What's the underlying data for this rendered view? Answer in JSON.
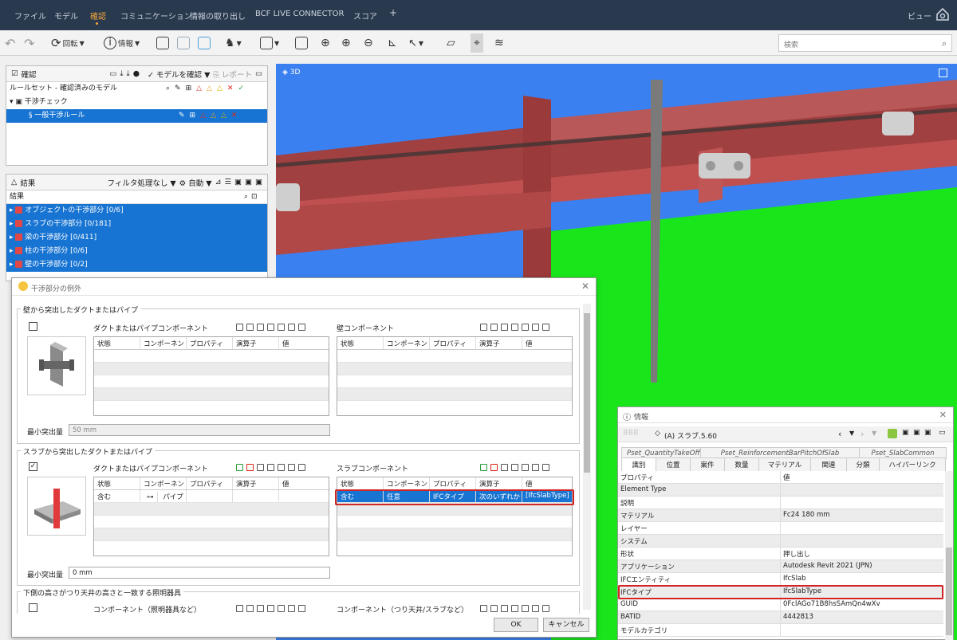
{
  "menu": {
    "items": [
      "ファイル",
      "モデル",
      "確認",
      "コミュニケーション",
      "情報の取り出し",
      "BCF LIVE CONNECTOR",
      "スコア",
      "+"
    ],
    "active_index": 2,
    "right": "ビュー"
  },
  "toolbar": {
    "rotate": "回転",
    "info": "情報",
    "search_placeholder": "検索"
  },
  "check_panel": {
    "title": "確認",
    "check_model": "モデルを確認",
    "report": "レポート",
    "ruleset": "ルールセット - 確認済みのモデル",
    "clash_check": "干渉チェック",
    "general_rule": "一般干渉ルール"
  },
  "results_panel": {
    "title": "結果",
    "filter": "フィルタ処理なし",
    "auto": "自動",
    "column": "結果",
    "items": [
      "オブジェクトの干渉部分 [0/6]",
      "スラブの干渉部分 [0/181]",
      "梁の干渉部分 [0/411]",
      "柱の干渉部分 [0/6]",
      "壁の干渉部分 [0/2]"
    ]
  },
  "view3d": {
    "label": "3D"
  },
  "dialog": {
    "title": "干渉部分の例外",
    "group1": {
      "title": "壁から突出したダクトまたはパイプ",
      "left_label": "ダクトまたはパイプコンポーネント",
      "right_label": "壁コンポーネント",
      "min_label": "最小突出量",
      "min_value": "50 mm"
    },
    "group2": {
      "title": "スラブから突出したダクトまたはパイプ",
      "left_label": "ダクトまたはパイプコンポーネント",
      "right_label": "スラブコンポーネント",
      "left_row": [
        "含む",
        "パイプ",
        "",
        "",
        ""
      ],
      "right_row": [
        "含む",
        "任意",
        "IFCタイプ",
        "次のいずれか",
        "[IfcSlabType]"
      ],
      "min_label": "最小突出量",
      "min_value": "0 mm"
    },
    "group3": {
      "title": "下側の高さがつり天井の高さと一致する照明器具",
      "left_label": "コンポーネント（照明器具など）",
      "right_label": "コンポーネント（つり天井/スラブなど）"
    },
    "columns": [
      "状態",
      "コンポーネント",
      "プロパティ",
      "演算子",
      "値"
    ],
    "ok": "OK",
    "cancel": "キャンセル"
  },
  "info": {
    "title": "情報",
    "object": "(A) スラブ.5.60",
    "tabs_top": [
      "Pset_QuantityTakeOff",
      "Pset_ReinforcementBarPitchOfSlab",
      "Pset_SlabCommon"
    ],
    "tabs": [
      "識別",
      "位置",
      "案件",
      "数量",
      "マテリアル",
      "関連",
      "分類",
      "ハイパーリンク"
    ],
    "head": [
      "プロパティ",
      "値"
    ],
    "rows": [
      [
        "Element Type",
        ""
      ],
      [
        "説明",
        ""
      ],
      [
        "マテリアル",
        "Fc24 180 mm"
      ],
      [
        "レイヤー",
        ""
      ],
      [
        "システム",
        ""
      ],
      [
        "形状",
        "押し出し"
      ],
      [
        "アプリケーション",
        "Autodesk Revit 2021 (JPN)"
      ],
      [
        "IFCエンティティ",
        "IfcSlab"
      ],
      [
        "IFCタイプ",
        "IfcSlabType"
      ],
      [
        "GUID",
        "0FclAGo71B8hsSAmQn4wXv"
      ],
      [
        "BATID",
        "4442813"
      ],
      [
        "モデルカテゴリ",
        ""
      ]
    ]
  },
  "colors": {
    "menubar": "#2a3a4e",
    "accent": "#f2a33a",
    "selection": "#1874d2",
    "highlight": "#d32424",
    "sky": "#3a80f0",
    "slab": "#19e51b",
    "beam": "#b04848"
  }
}
